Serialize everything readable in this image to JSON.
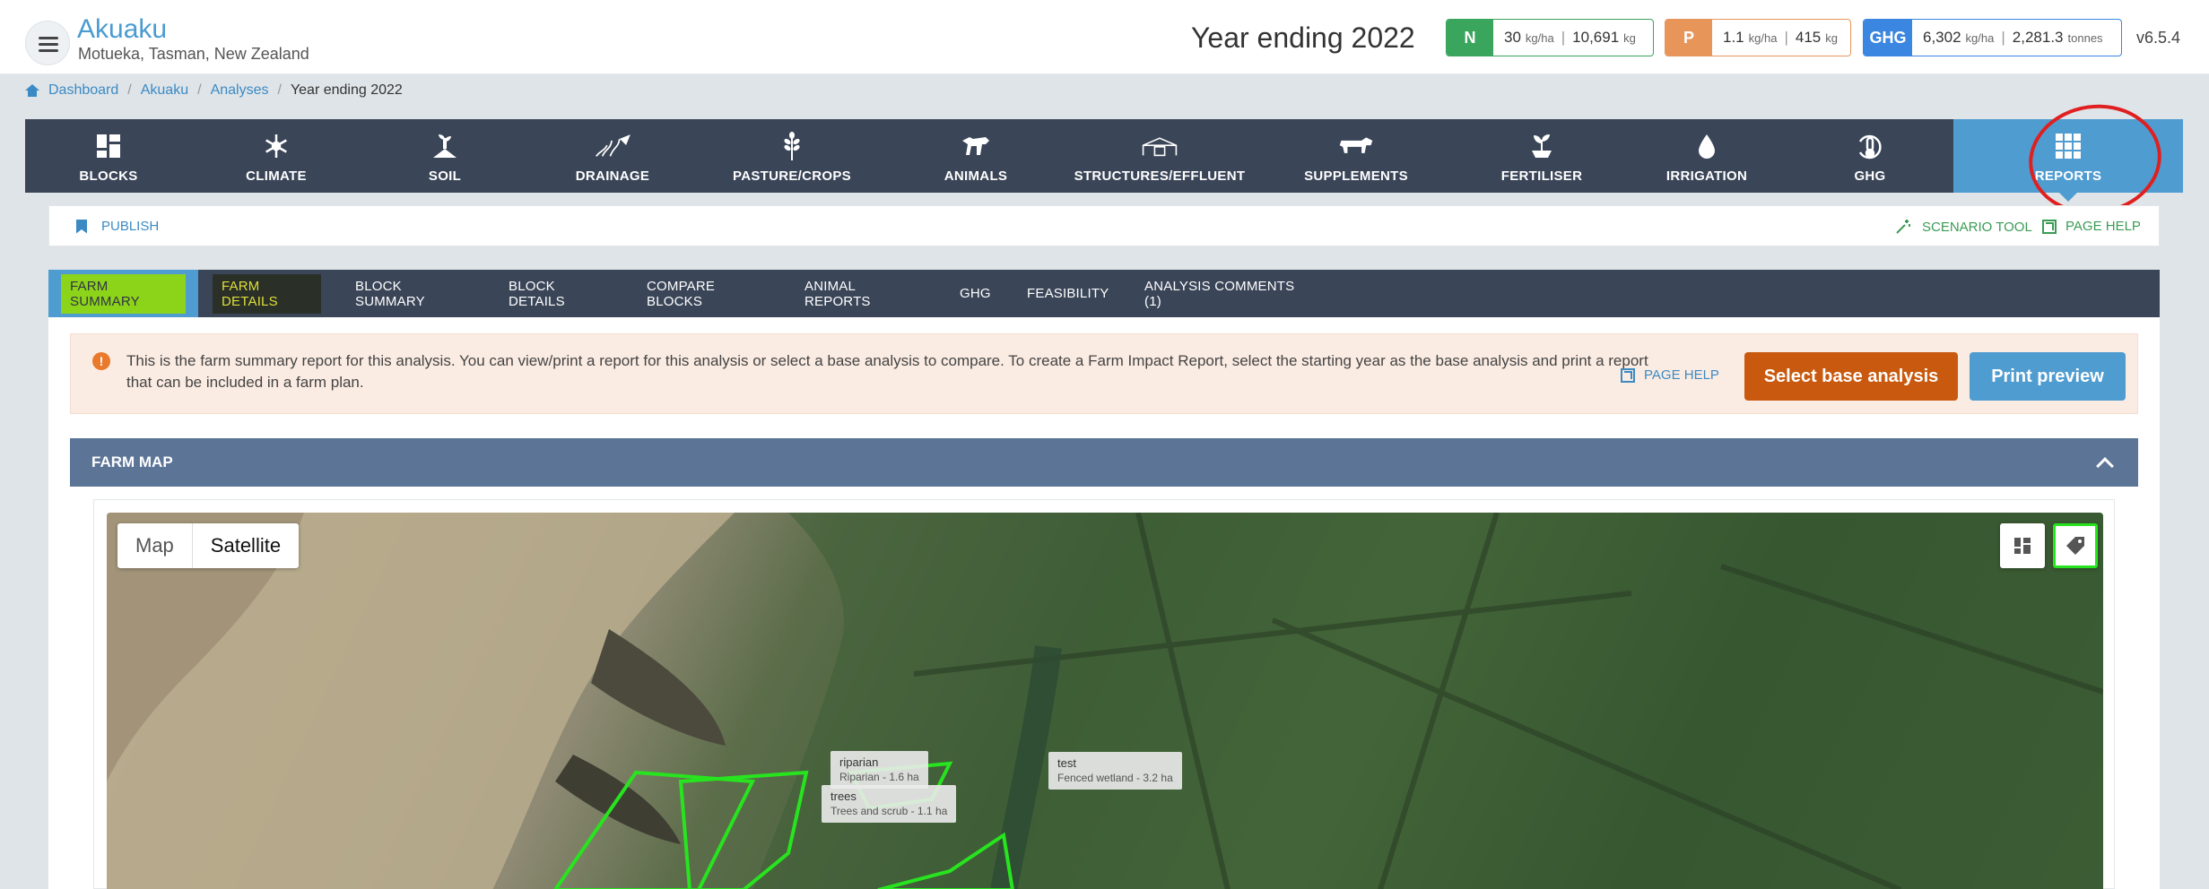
{
  "header": {
    "farm_name": "Akuaku",
    "farm_location": "Motueka, Tasman, New Zealand",
    "year_title": "Year ending 2022",
    "metrics": {
      "n": {
        "tag": "N",
        "rate": "30",
        "rate_unit": "kg/ha",
        "total": "10,691",
        "total_unit": "kg",
        "color": "#3aa55d"
      },
      "p": {
        "tag": "P",
        "rate": "1.1",
        "rate_unit": "kg/ha",
        "total": "415",
        "total_unit": "kg",
        "color": "#e8955a"
      },
      "ghg": {
        "tag": "GHG",
        "rate": "6,302",
        "rate_unit": "kg/ha",
        "total": "2,281.3",
        "total_unit": "tonnes",
        "color": "#3a86e0"
      }
    },
    "version": "v6.5.4"
  },
  "breadcrumb": {
    "items": [
      "Dashboard",
      "Akuaku",
      "Analyses"
    ],
    "current": "Year ending 2022"
  },
  "main_nav": {
    "items": [
      {
        "label": "BLOCKS",
        "icon": "blocks-icon"
      },
      {
        "label": "CLIMATE",
        "icon": "snowflake-icon"
      },
      {
        "label": "SOIL",
        "icon": "soil-icon"
      },
      {
        "label": "DRAINAGE",
        "icon": "drainage-icon"
      },
      {
        "label": "PASTURE/CROPS",
        "icon": "wheat-icon"
      },
      {
        "label": "ANIMALS",
        "icon": "animal-icon"
      },
      {
        "label": "STRUCTURES/EFFLUENT",
        "icon": "shed-icon"
      },
      {
        "label": "SUPPLEMENTS",
        "icon": "cow-icon"
      },
      {
        "label": "FERTILISER",
        "icon": "seedling-icon"
      },
      {
        "label": "IRRIGATION",
        "icon": "water-drop-icon"
      },
      {
        "label": "GHG",
        "icon": "thermometer-icon"
      },
      {
        "label": "REPORTS",
        "icon": "grid-icon"
      }
    ],
    "active": "REPORTS"
  },
  "toolbar": {
    "publish": "PUBLISH",
    "scenario_tool": "SCENARIO TOOL",
    "page_help": "PAGE HELP"
  },
  "report_tabs": {
    "items": [
      "FARM SUMMARY",
      "FARM DETAILS",
      "BLOCK SUMMARY",
      "BLOCK DETAILS",
      "COMPARE BLOCKS",
      "ANIMAL REPORTS",
      "GHG",
      "FEASIBILITY",
      "ANALYSIS COMMENTS (1)"
    ],
    "active": "FARM SUMMARY"
  },
  "notice": {
    "text": "This is the farm summary report for this analysis. You can view/print a report for this analysis or select a base analysis to compare. To create a Farm Impact Report, select the starting year as the base analysis and print a report that can be included in a farm plan.",
    "page_help": "PAGE HELP",
    "select_base": "Select base analysis",
    "print_preview": "Print preview"
  },
  "farm_map": {
    "title": "FARM MAP",
    "toggle": {
      "map": "Map",
      "satellite": "Satellite",
      "selected": "Satellite"
    },
    "labels": [
      {
        "name": "riparian",
        "detail": "Riparian - 1.6 ha"
      },
      {
        "name": "trees",
        "detail": "Trees and scrub - 1.1 ha"
      },
      {
        "name": "test",
        "detail": "Fenced wetland - 3.2 ha"
      }
    ]
  }
}
